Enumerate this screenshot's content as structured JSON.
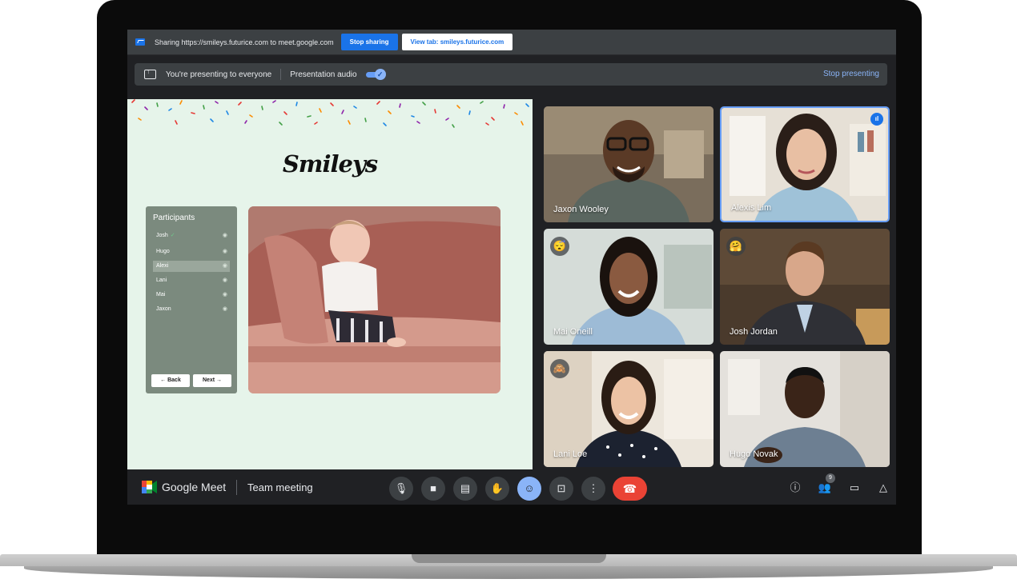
{
  "share_bar": {
    "text": "Sharing https://smileys.futurice.com to meet.google.com",
    "stop_sharing_label": "Stop sharing",
    "view_tab_label": "View tab: smileys.futurice.com"
  },
  "present_bar": {
    "presenting_text": "You're presenting to everyone",
    "audio_label": "Presentation audio",
    "audio_enabled": true,
    "stop_presenting_label": "Stop presenting"
  },
  "shared_tab": {
    "logo_text": "Smileys",
    "panel_title": "Participants",
    "participants": [
      {
        "name": "Josh",
        "checked": true,
        "selected": false
      },
      {
        "name": "Hugo",
        "checked": false,
        "selected": false
      },
      {
        "name": "Alexi",
        "checked": false,
        "selected": true
      },
      {
        "name": "Lani",
        "checked": false,
        "selected": false
      },
      {
        "name": "Mai",
        "checked": false,
        "selected": false
      },
      {
        "name": "Jaxon",
        "checked": false,
        "selected": false
      }
    ],
    "back_label": "← Back",
    "next_label": "Next →"
  },
  "tiles": [
    {
      "name": "Jaxon Wooley",
      "emoji": "",
      "speaking": false
    },
    {
      "name": "Alexis Lim",
      "emoji": "",
      "speaking": true
    },
    {
      "name": "Mai Oneill",
      "emoji": "😴",
      "speaking": false
    },
    {
      "name": "Josh Jordan",
      "emoji": "🤗",
      "speaking": false
    },
    {
      "name": "Lani Loe",
      "emoji": "🙈",
      "speaking": false
    },
    {
      "name": "Hugo Novak",
      "emoji": "",
      "speaking": false
    }
  ],
  "control_bar": {
    "app_name": "Google Meet",
    "meeting_name": "Team meeting",
    "people_count": "9"
  },
  "colors": {
    "accent_blue": "#1a73e8",
    "active_control": "#8ab4f8",
    "end_call_red": "#ea4335",
    "shared_bg": "#e6f4ea"
  }
}
